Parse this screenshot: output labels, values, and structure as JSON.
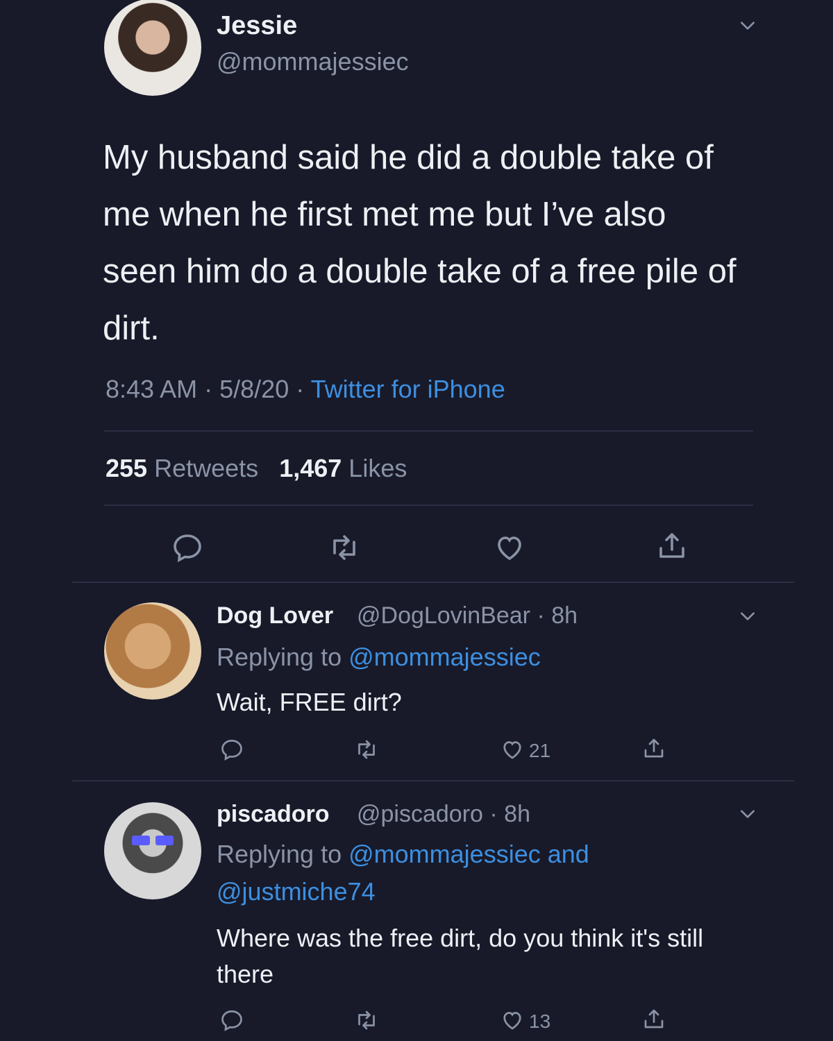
{
  "main": {
    "display_name": "Jessie",
    "handle": "@mommajessiec",
    "text": "My husband said he did a double take of me when he first met me but I’ve also seen him do a double take of a free pile of dirt.",
    "time": "8:43 AM",
    "date": "5/8/20",
    "source": "Twitter for iPhone",
    "separator": "·",
    "retweets_count": "255",
    "retweets_label": "Retweets",
    "likes_count": "1,467",
    "likes_label": "Likes"
  },
  "replies": [
    {
      "display_name": "Dog Lover",
      "handle": "@DogLovinBear",
      "time": "8h",
      "replying_prefix": "Replying to",
      "mention_line1": "@mommajessiec",
      "mention_line2": "",
      "text": "Wait, FREE dirt?",
      "likes": "21"
    },
    {
      "display_name": "piscadoro",
      "handle": "@piscadoro",
      "time": "8h",
      "replying_prefix": "Replying to",
      "mention_line1": "@mommajessiec and",
      "mention_line2": "@justmiche74",
      "text": "Where was the free dirt, do you think it's still there",
      "likes": "13"
    }
  ],
  "icons": {
    "reply": "reply-icon",
    "retweet": "retweet-icon",
    "like": "heart-icon",
    "share": "share-icon",
    "more": "chevron-down-icon"
  },
  "colors": {
    "background": "#181a2a",
    "text": "#eef0f4",
    "muted": "#8b93a6",
    "link": "#3d8fe0"
  }
}
